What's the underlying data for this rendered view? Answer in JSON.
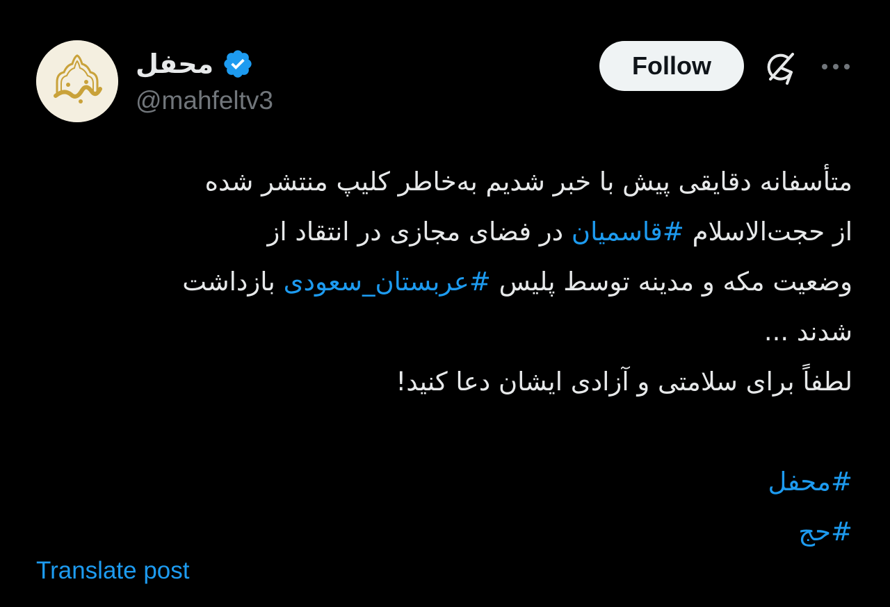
{
  "author": {
    "display_name": "محفل",
    "handle": "@mahfeltv3",
    "avatar_icon": "mahfel-logo-icon",
    "verified_icon": "verified-badge-icon"
  },
  "actions": {
    "follow_label": "Follow",
    "grok_icon": "grok-icon",
    "more_icon": "more-options-icon"
  },
  "post": {
    "line1": "متأسفانه دقایقی پیش با خبر شدیم به‌خاطر کلیپ منتشر شده",
    "line2_before": "از حجت‌الاسلام ",
    "line2_tag": "#قاسمیان",
    "line2_after": " در فضای مجازی در انتقاد از",
    "line3_before": "وضعیت مکه و مدینه توسط پلیس ",
    "line3_tag": "#عربستان_سعودی",
    "line3_after": " بازداشت",
    "line4": "شدند ...",
    "line5": "لطفاً برای سلامتی و آزادی ایشان دعا کنید!",
    "tag1": "#محفل",
    "tag2": "#حج"
  },
  "translate_label": "Translate post",
  "colors": {
    "background": "#000000",
    "text": "#e7e9ea",
    "muted": "#71767b",
    "link": "#1d9bf0",
    "follow_bg": "#eff3f4",
    "verified": "#1d9bf0",
    "logo_gold": "#c9a23a"
  }
}
